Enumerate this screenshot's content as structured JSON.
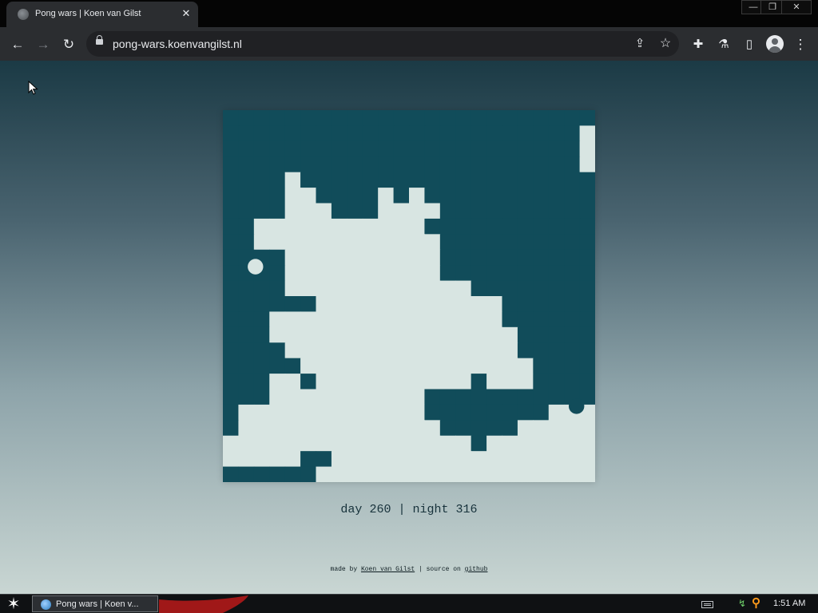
{
  "window": {
    "tab_title": "Pong wars | Koen van Gilst",
    "tab_close": "✕",
    "minimize": "—",
    "restore": "❐",
    "close": "✕"
  },
  "toolbar": {
    "back": "←",
    "forward": "→",
    "reload": "↻",
    "url": "pong-wars.koenvangilst.nl",
    "share": "⇪",
    "bookmark": "☆",
    "extensions": "✚",
    "labs": "⚗",
    "side_panel": "▯",
    "menu": "⋮"
  },
  "game": {
    "colors": {
      "day": "#d8e5e2",
      "night": "#114c5a"
    },
    "grid_size": 24,
    "board_rows": [
      "NNNNNNNNNNNNNNNNNNNNNNNN",
      "NNNNNNNNNNNNNNNNNNNNNNND",
      "NNNNNNNNNNNNNNNNNNNNNNND",
      "NNNNNNNNNNNNNNNNNNNNNNND",
      "NNNNDNNNNNNNNNNNNNNNNNNN",
      "NNNNDDNNNNDNDNNNNNNNNNNN",
      "NNNNDDDNNNDDDDNNNNNNNNNN",
      "NNDDDDDDDDDDDNNNNNNNNNNN",
      "NNDDDDDDDDDDDDNNNNNNNNNN",
      "NNNNDDDDDDDDDDNNNNNNNNNN",
      "NNNNDDDDDDDDDDNNNNNNNNNN",
      "NNNNDDDDDDDDDDDDNNNNNNNN",
      "NNNNNNDDDDDDDDDDDDNNNNNN",
      "NNNDDDDDDDDDDDDDDDNNNNNN",
      "NNNDDDDDDDDDDDDDDDDNNNNN",
      "NNNNDDDDDDDDDDDDDDDNNNNN",
      "NNNNNDDDDDDDDDDDDDDDNNNN",
      "NNNDDNDDDDDDDDDDNDDDNNNN",
      "NNNDDDDDDDDDDNNNNNNNNNNN",
      "NDDDDDDDDDDDDNNNNNNNNDDD",
      "NDDDDDDDDDDDDDNNNNNDDDDD",
      "DDDDDDDDDDDDDDDDNDDDDDDD",
      "DDDDDNNDDDDDDDDDDDDDDDDD",
      "NNNNNNDDDDDDDDDDDDDDDDDD"
    ],
    "balls": [
      {
        "type": "day",
        "col": 2.1,
        "row": 10.1
      },
      {
        "type": "night",
        "col": 22.8,
        "row": 19.1
      }
    ]
  },
  "score": {
    "day_label": "day",
    "day_count": "260",
    "separator": "|",
    "night_label": "night",
    "night_count": "316"
  },
  "footer": {
    "made_by": "made by",
    "author": "Koen van Gilst",
    "separator": "|",
    "source_on": "source on",
    "github": "github"
  },
  "taskbar": {
    "start": "✶",
    "task_label": "Pong wars | Koen v...",
    "clock": "1:51 AM"
  }
}
